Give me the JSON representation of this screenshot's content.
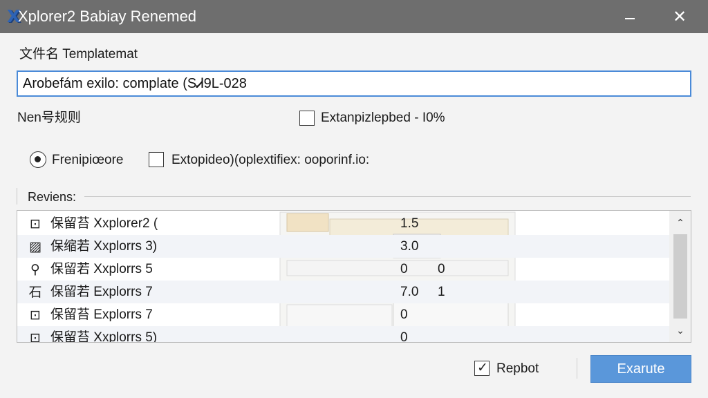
{
  "window": {
    "title": "Xplorer2  Babiay Renemed",
    "minimize_icon": "minimize-icon",
    "close_icon": "close-icon",
    "close_glyph": "✕",
    "logo_glyph": "X"
  },
  "form": {
    "template_label": "文件名 Templatemat",
    "template_value": "Arobefám exilo: complate (SᏗ9L-028",
    "numbering_label": "Nen号规则",
    "extension_checkbox": {
      "label": "Extanpizlepbed  - I0%",
      "checked": false
    },
    "radio_option": {
      "label": "Frenipiœore",
      "selected": true
    },
    "option_checkbox": {
      "label": "Extopideo)(oplextifiex: ooporinf.io:",
      "checked": false
    }
  },
  "reviews": {
    "label": "Reviens:",
    "rows": [
      {
        "icon": "tagged-file-icon",
        "glyph": "⊡",
        "name": "保留苔 Xxplorer2 (",
        "value1": "1.5",
        "value2": ""
      },
      {
        "icon": "image-file-icon",
        "glyph": "▨",
        "name": "保缩若 Xxplorrs 3)",
        "value1": "3.0",
        "value2": ""
      },
      {
        "icon": "location-pin-icon",
        "glyph": "⚲",
        "name": "保留若 Xxplorrs 5",
        "value1": "0",
        "value2": "0"
      },
      {
        "icon": "glyph-icon",
        "glyph": "石",
        "name": "保留若 Explorrs 7",
        "value1": "7.0",
        "value2": "1"
      },
      {
        "icon": "document-icon",
        "glyph": "⊡",
        "name": "保留苔 Explorrs 7",
        "value1": "0",
        "value2": ""
      },
      {
        "icon": "document-icon",
        "glyph": "⊡",
        "name": "保留苔 Xxplorrs 5)",
        "value1": "0",
        "value2": ""
      }
    ],
    "scroll_up_icon": "chevron-up-icon",
    "scroll_down_icon": "chevron-down-icon",
    "scroll_up_glyph": "⌃",
    "scroll_down_glyph": "⌄"
  },
  "footer": {
    "report_checkbox": {
      "label": "Repbot",
      "checked": true,
      "tick": "✓"
    },
    "execute_label": "Exarute"
  },
  "colors": {
    "titlebar": "#6e6e6e",
    "accent": "#5a97da",
    "input_border": "#4a8ad8"
  }
}
